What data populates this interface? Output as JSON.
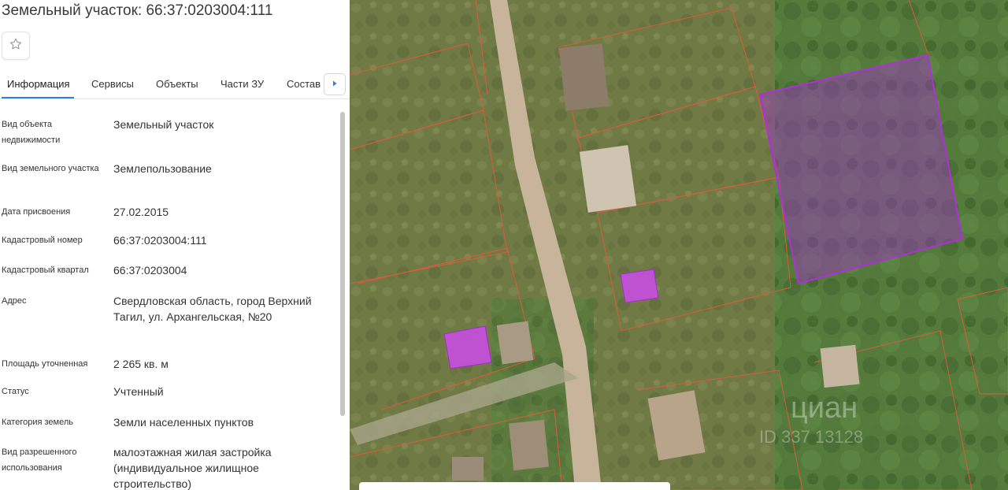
{
  "header": {
    "title": "Земельный участок: 66:37:0203004:111"
  },
  "tabs": [
    {
      "label": "Информация"
    },
    {
      "label": "Сервисы"
    },
    {
      "label": "Объекты"
    },
    {
      "label": "Части ЗУ"
    },
    {
      "label": "Состав"
    }
  ],
  "properties": [
    {
      "label": "Вид объекта недвижимости",
      "value": "Земельный участок"
    },
    {
      "label": "Вид земельного участка",
      "value": "Землепользование"
    },
    {
      "label": "Дата присвоения",
      "value": "27.02.2015"
    },
    {
      "label": "Кадастровый номер",
      "value": "66:37:0203004:111"
    },
    {
      "label": "Кадастровый квартал",
      "value": "66:37:0203004"
    },
    {
      "label": "Адрес",
      "value": "Свердловская область, город Верхний Тагил, ул. Архангельская, №20"
    },
    {
      "label": "Площадь уточненная",
      "value": "2 265 кв. м"
    },
    {
      "label": "Статус",
      "value": "Учтенный"
    },
    {
      "label": "Категория земель",
      "value": "Земли населенных пунктов"
    },
    {
      "label": "Вид разрешенного использования",
      "value": "малоэтажная жилая застройка (индивидуальное жилищное строительство)"
    }
  ],
  "map": {
    "watermark_line1": "циан",
    "watermark_line2": "ID 337 13128",
    "colors": {
      "selected_parcel": "#a030c8",
      "building_highlight": "#c84ee0",
      "parcel_border": "#e05a3a",
      "road": "#c8b49a"
    }
  },
  "icons": {
    "favorite": "star-outline-icon",
    "tabs_scroll": "chevron-right-icon"
  }
}
